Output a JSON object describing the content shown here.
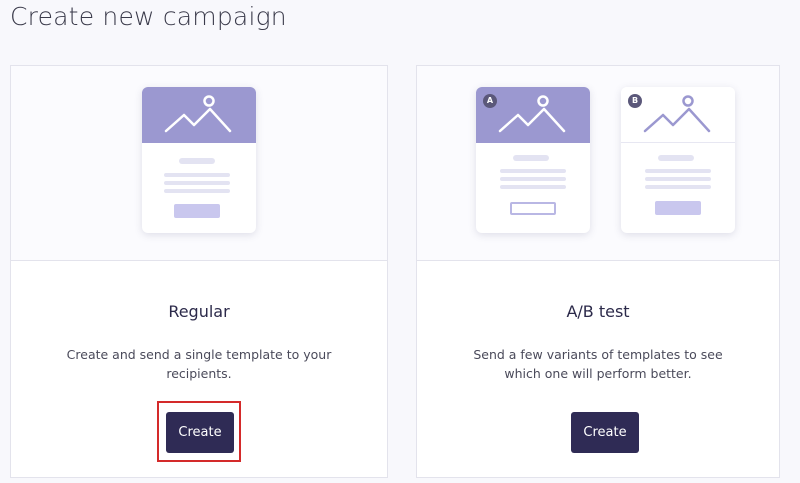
{
  "page": {
    "title": "Create new campaign"
  },
  "cards": [
    {
      "title": "Regular",
      "description": "Create and send a single template to your recipients.",
      "button_label": "Create",
      "illustration": [
        "image-icon"
      ]
    },
    {
      "title": "A/B test",
      "description": "Send a few variants of templates to see which one will perform better.",
      "button_label": "Create",
      "illustration": [
        "image-icon",
        "image-icon"
      ],
      "variant_badges": [
        "A",
        "B"
      ]
    }
  ],
  "colors": {
    "accent": "#2f2b55",
    "template_header": "#9b98d0",
    "highlight": "#d42a2a",
    "placeholder_bar": "#e3e3f2",
    "placeholder_button": "#c9c7ee"
  }
}
